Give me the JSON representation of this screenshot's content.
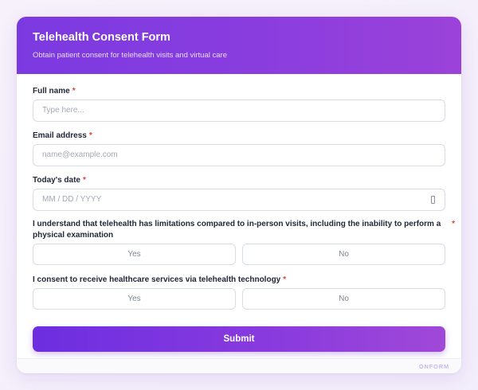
{
  "form": {
    "title": "Telehealth Consent Form",
    "subtitle": "Obtain patient consent for telehealth visits and virtual care"
  },
  "fields": {
    "full_name": {
      "label": "Full name",
      "required_mark": "*",
      "placeholder": "Type here..."
    },
    "email": {
      "label": "Email address",
      "required_mark": "*",
      "placeholder": "name@example.com"
    },
    "date": {
      "label": "Today's date",
      "required_mark": "*",
      "placeholder": "MM / DD / YYYY"
    }
  },
  "questions": {
    "limitations": {
      "label": "I understand that telehealth has limitations compared to in-person visits, including the inability to perform a physical examination",
      "required_mark": "*",
      "yes": "Yes",
      "no": "No"
    },
    "consent": {
      "label": "I consent to receive healthcare services via telehealth technology",
      "required_mark": "*",
      "yes": "Yes",
      "no": "No"
    }
  },
  "actions": {
    "submit_label": "Submit"
  },
  "footer": {
    "brand": "ONFORM"
  },
  "colors": {
    "accent_start": "#6c2ee0",
    "accent_end": "#a048d8",
    "required": "#e0413a"
  },
  "icons": {
    "date_picker": "calendar-icon"
  }
}
